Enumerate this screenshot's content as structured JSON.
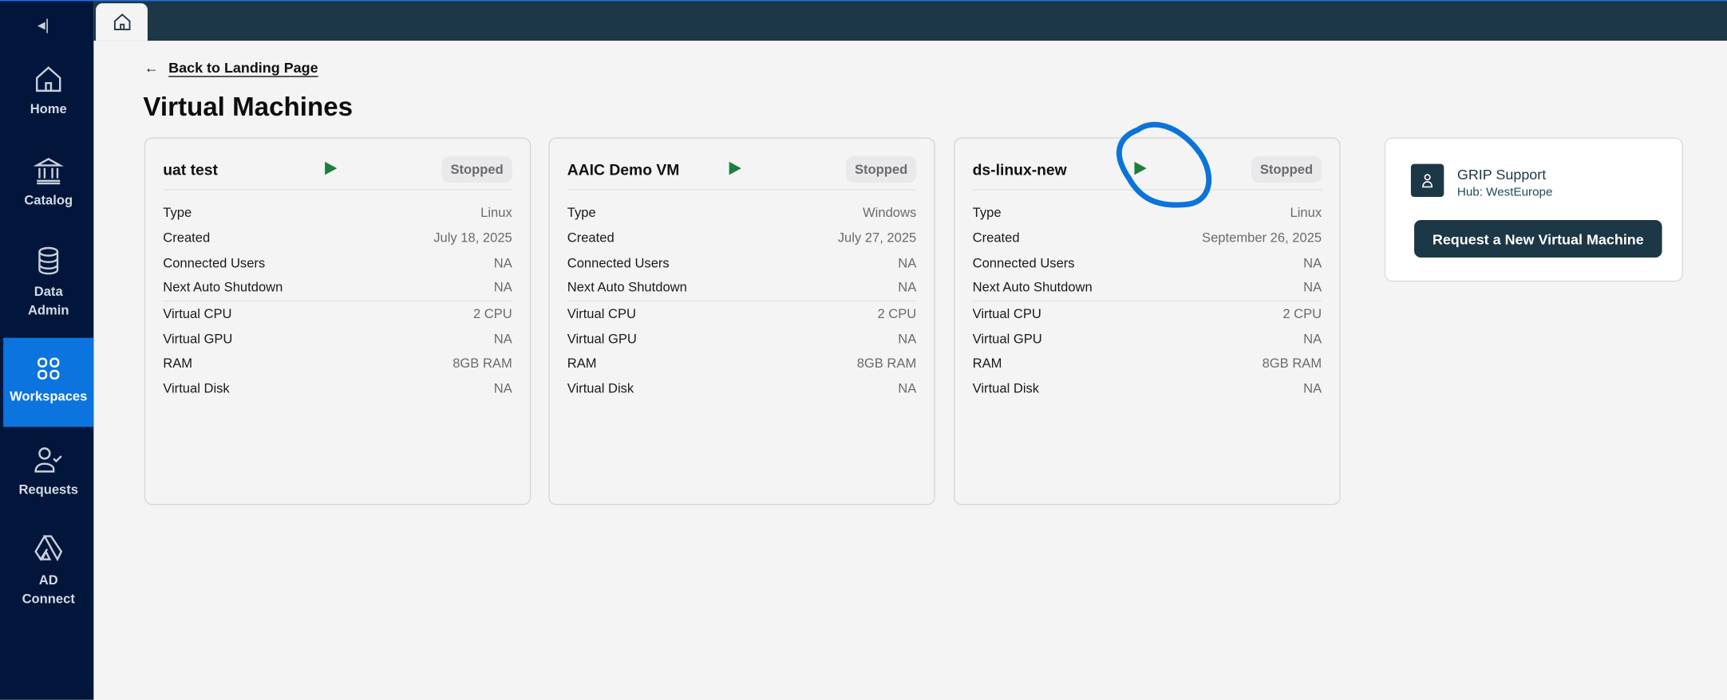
{
  "sidebar": {
    "items": [
      {
        "label": "Home",
        "icon": "home-icon"
      },
      {
        "label": "Catalog",
        "icon": "bank-icon"
      },
      {
        "label": "Data Admin",
        "icon": "database-icon"
      },
      {
        "label": "Workspaces",
        "icon": "grid-icon",
        "active": true
      },
      {
        "label": "Requests",
        "icon": "user-check-icon"
      },
      {
        "label": "AD Connect",
        "icon": "connect-icon"
      }
    ]
  },
  "header": {
    "back_label": "Back to Landing Page",
    "title": "Virtual Machines"
  },
  "vms": [
    {
      "name": "uat test",
      "status": "Stopped",
      "rows": [
        [
          "Type",
          "Linux"
        ],
        [
          "Created",
          "July 18, 2025"
        ],
        [
          "Connected Users",
          "NA"
        ],
        [
          "Next Auto Shutdown",
          "NA"
        ],
        [
          "Virtual CPU",
          "2 CPU"
        ],
        [
          "Virtual GPU",
          "NA"
        ],
        [
          "RAM",
          "8GB RAM"
        ],
        [
          "Virtual Disk",
          "NA"
        ]
      ]
    },
    {
      "name": "AAIC Demo VM",
      "status": "Stopped",
      "rows": [
        [
          "Type",
          "Windows"
        ],
        [
          "Created",
          "July 27, 2025"
        ],
        [
          "Connected Users",
          "NA"
        ],
        [
          "Next Auto Shutdown",
          "NA"
        ],
        [
          "Virtual CPU",
          "2 CPU"
        ],
        [
          "Virtual GPU",
          "NA"
        ],
        [
          "RAM",
          "8GB RAM"
        ],
        [
          "Virtual Disk",
          "NA"
        ]
      ]
    },
    {
      "name": "ds-linux-new",
      "status": "Stopped",
      "rows": [
        [
          "Type",
          "Linux"
        ],
        [
          "Created",
          "September 26, 2025"
        ],
        [
          "Connected Users",
          "NA"
        ],
        [
          "Next Auto Shutdown",
          "NA"
        ],
        [
          "Virtual CPU",
          "2 CPU"
        ],
        [
          "Virtual GPU",
          "NA"
        ],
        [
          "RAM",
          "8GB RAM"
        ],
        [
          "Virtual Disk",
          "NA"
        ]
      ]
    }
  ],
  "support": {
    "name": "GRIP Support",
    "hub": "Hub: WestEurope",
    "request_label": "Request a New Virtual Machine"
  },
  "colors": {
    "sidebar": "#01163a",
    "active": "#0b74de",
    "topbar": "#1c3745",
    "play": "#1e7e3e",
    "annotation": "#0a74da"
  }
}
